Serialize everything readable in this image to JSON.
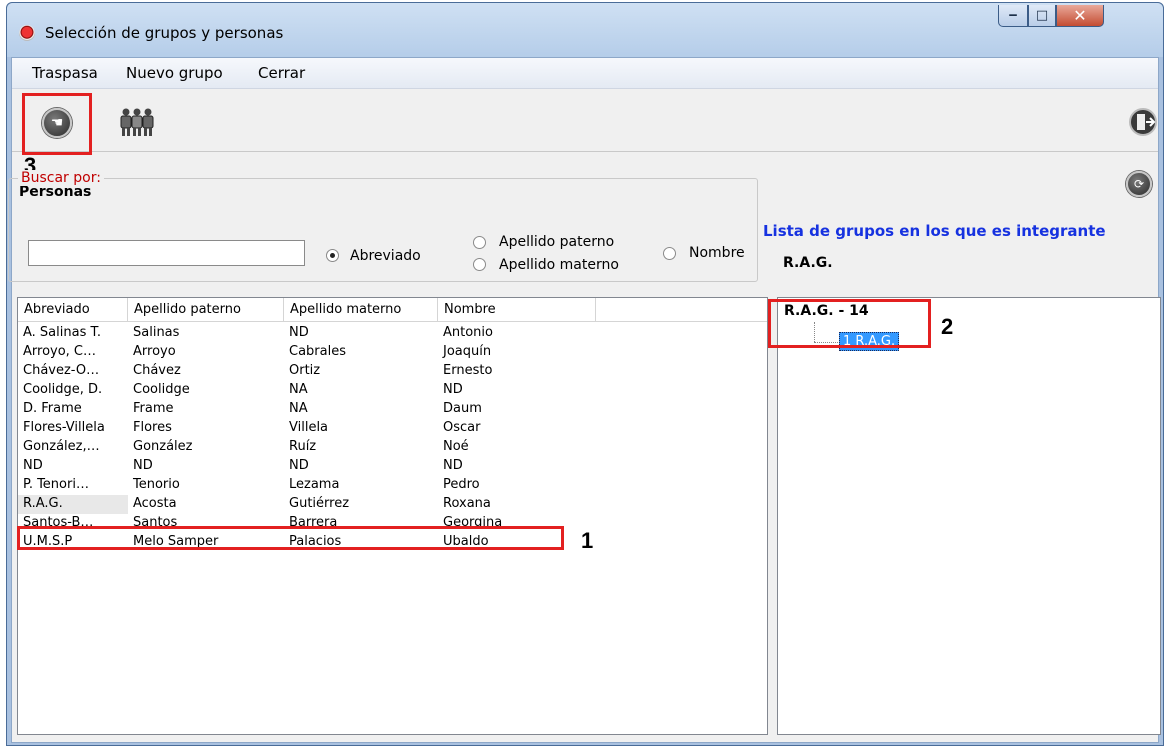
{
  "window": {
    "title": "Selección de grupos y personas",
    "min": "‒",
    "max": "□",
    "close": "✕"
  },
  "menu": [
    "Traspasa",
    "Nuevo grupo",
    "Cerrar"
  ],
  "toolbar": {
    "transfer_icon": "pointing-hand-icon",
    "people_icon": "people-icon",
    "exit_icon": "exit-door-icon"
  },
  "annotations": [
    "3",
    "2",
    "1"
  ],
  "section_label": "Personas",
  "search": {
    "legend": "Buscar por:",
    "value": "",
    "options": [
      {
        "label": "Abreviado",
        "checked": true
      },
      {
        "label": "Apellido paterno",
        "checked": false
      },
      {
        "label": "Apellido materno",
        "checked": false
      },
      {
        "label": "Nombre",
        "checked": false
      }
    ]
  },
  "right_panel": {
    "title": "Lista de grupos en los que es integrante",
    "selected_person": "R.A.G.",
    "tree_root": "R.A.G. - 14",
    "tree_child": "1 R.A.G."
  },
  "table": {
    "columns": [
      "Abreviado",
      "Apellido paterno",
      "Apellido materno",
      "Nombre"
    ],
    "rows": [
      [
        "A. Salinas T.",
        "Salinas",
        "ND",
        "Antonio"
      ],
      [
        "Arroyo, C…",
        "Arroyo",
        "Cabrales",
        "Joaquín"
      ],
      [
        "Chávez-O…",
        "Chávez",
        "Ortiz",
        "Ernesto"
      ],
      [
        "Coolidge, D.",
        "Coolidge",
        "NA",
        "ND"
      ],
      [
        "D. Frame",
        "Frame",
        "NA",
        "Daum"
      ],
      [
        "Flores-Villela",
        "Flores",
        "Villela",
        "Oscar"
      ],
      [
        "González,…",
        "González",
        "Ruíz",
        "Noé"
      ],
      [
        "ND",
        "ND",
        "ND",
        "ND"
      ],
      [
        "P. Tenori…",
        "Tenorio",
        "Lezama",
        "Pedro"
      ],
      [
        "R.A.G.",
        "Acosta",
        "Gutiérrez",
        "Roxana"
      ],
      [
        "Santos-B…",
        "Santos",
        "Barrera",
        "Georgina"
      ],
      [
        "U.M.S.P",
        "Melo Samper",
        "Palacios",
        "Ubaldo"
      ]
    ],
    "selected_row": 9
  },
  "colors": {
    "accent_blue": "#1632e0",
    "legend_red": "#c00000",
    "highlight_red": "#e32020",
    "tree_selection": "#3399ff"
  }
}
